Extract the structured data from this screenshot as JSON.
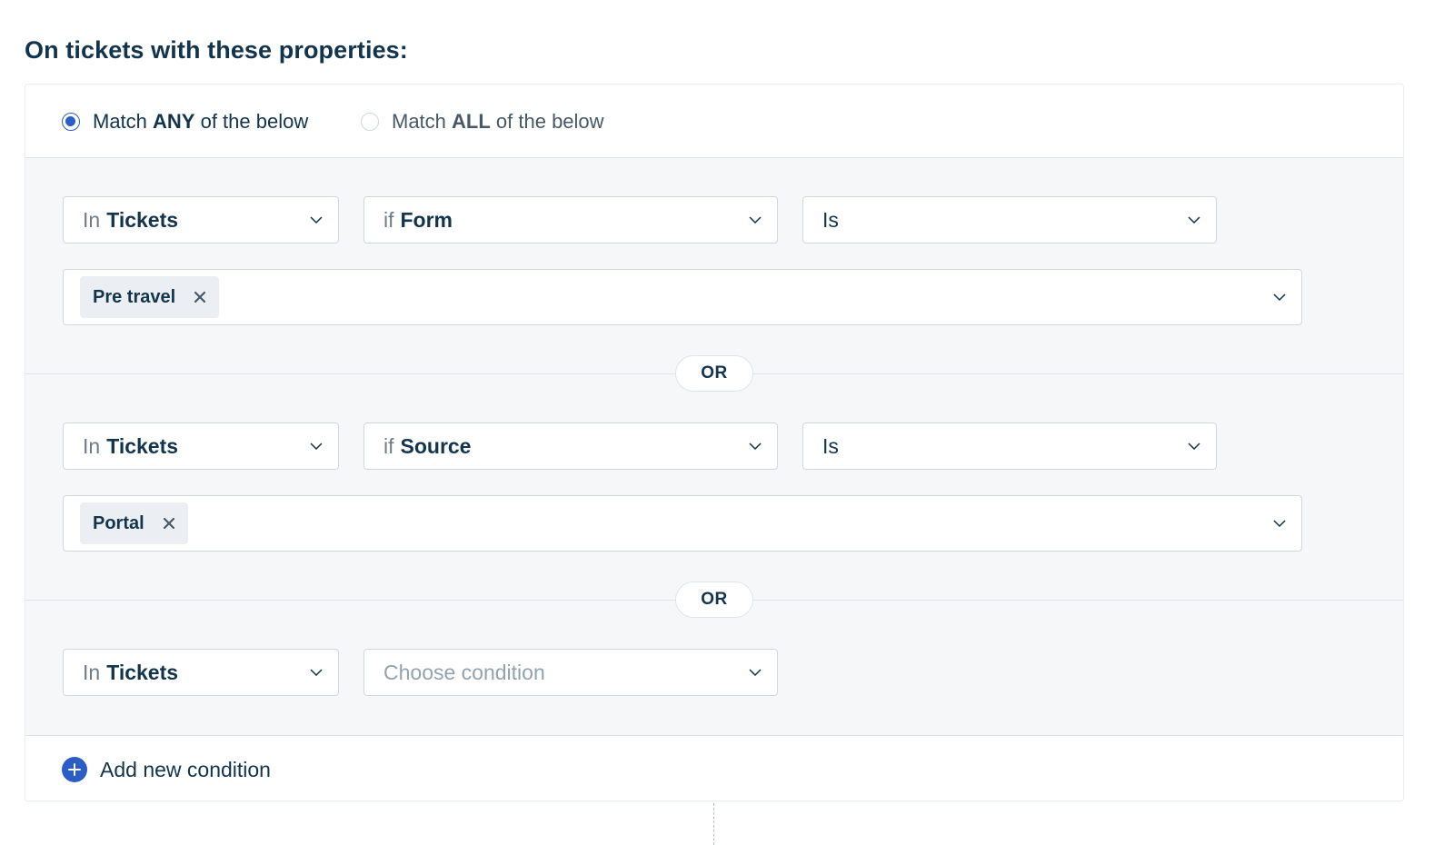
{
  "page": {
    "title": "On tickets with these properties:"
  },
  "match": {
    "any": {
      "prefix": "Match ",
      "keyword": "ANY",
      "suffix": " of the below",
      "selected": true
    },
    "all": {
      "prefix": "Match ",
      "keyword": "ALL",
      "suffix": " of the below",
      "selected": false
    }
  },
  "conditions": [
    {
      "scope": {
        "prefix": "In",
        "value": "Tickets"
      },
      "field": {
        "prefix": "if",
        "value": "Form"
      },
      "operator": "Is",
      "values": [
        "Pre travel"
      ]
    },
    {
      "scope": {
        "prefix": "In",
        "value": "Tickets"
      },
      "field": {
        "prefix": "if",
        "value": "Source"
      },
      "operator": "Is",
      "values": [
        "Portal"
      ]
    },
    {
      "scope": {
        "prefix": "In",
        "value": "Tickets"
      },
      "field": {
        "placeholder": "Choose condition"
      }
    }
  ],
  "connector": "OR",
  "add_condition_label": "Add new condition",
  "colors": {
    "accent": "#2c5cc5",
    "text": "#12344d",
    "muted": "#6f7c87",
    "border": "#cfd7df",
    "section_bg": "#f5f7f9",
    "chip_bg": "#ebeff3"
  },
  "icons": {
    "dropdown": "chevron-down-icon",
    "remove": "close-icon",
    "add": "plus-circle-icon"
  }
}
